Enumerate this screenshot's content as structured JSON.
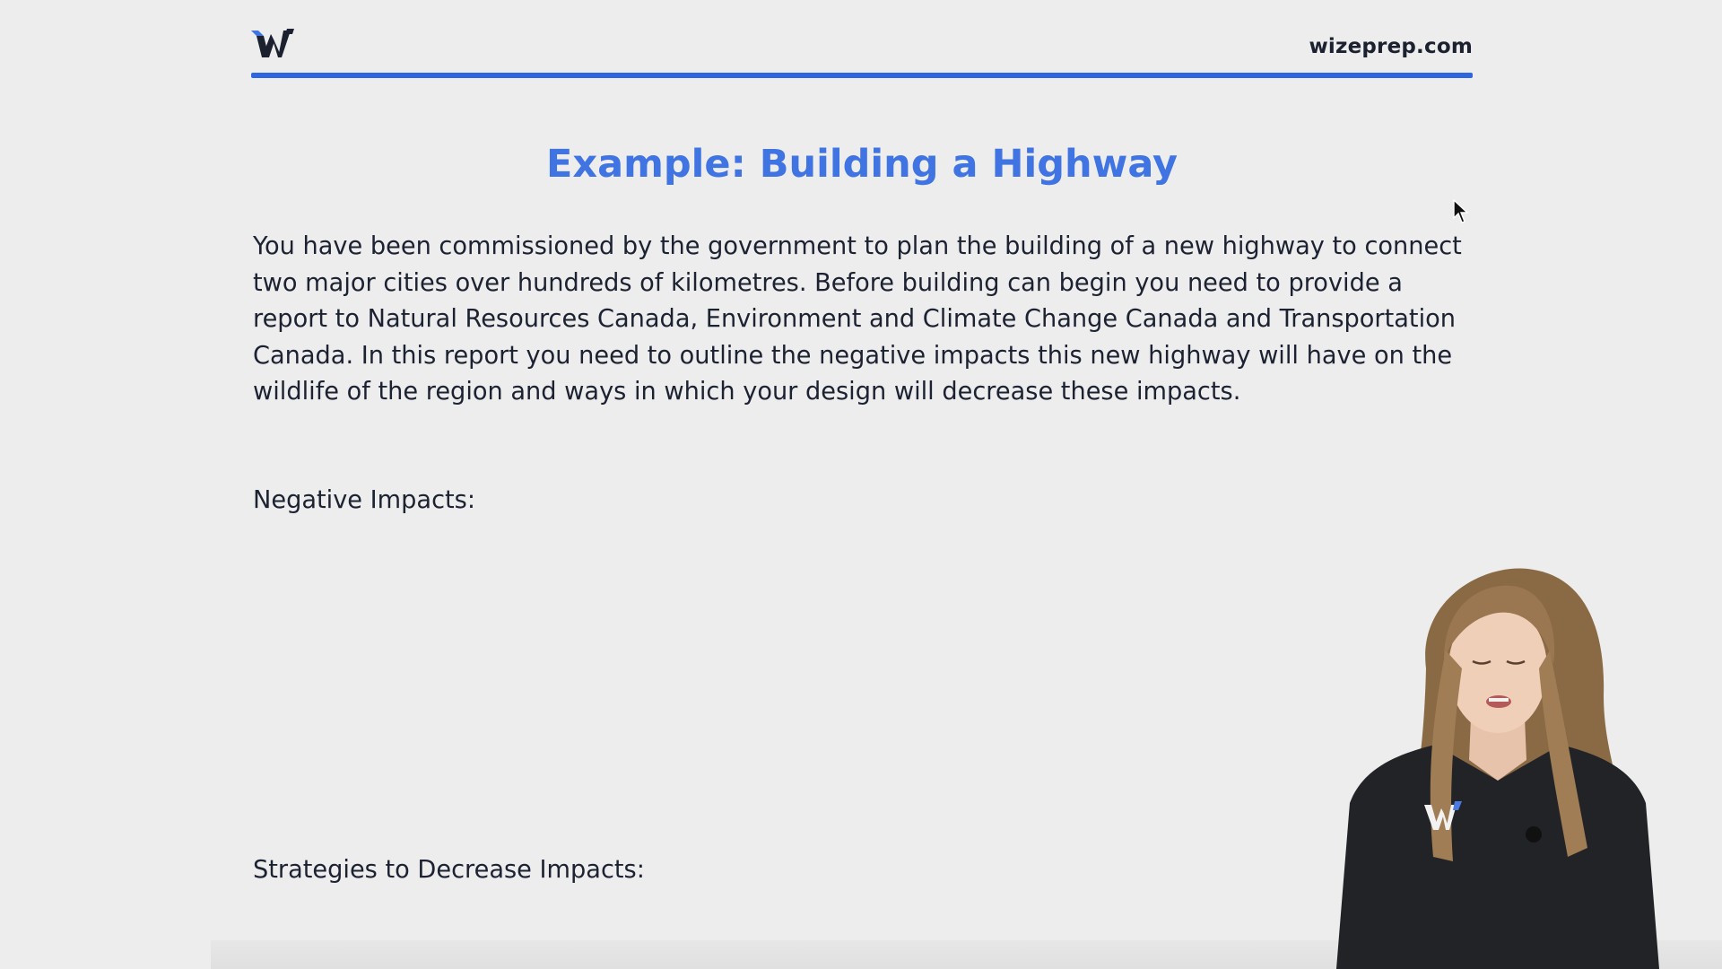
{
  "header": {
    "logo_icon": "wizeprep-w-logo-icon",
    "site_url": "wizeprep.com",
    "accent_color": "#2e66e0"
  },
  "slide": {
    "title": "Example: Building a Highway",
    "title_color": "#3f74e2",
    "body": "You have been commissioned by the government to plan the building of a new highway to connect two major cities over hundreds of kilometres. Before building can begin you need to provide a report to Natural Resources Canada, Environment and Climate Change Canada and Transportation Canada. In this report you need to outline the negative impacts this new highway will have on the wildlife of the region and ways in which your design will decrease these impacts.",
    "negative_impacts_label": "Negative Impacts:",
    "strategies_label": "Strategies to Decrease Impacts:"
  },
  "overlay": {
    "cursor_icon": "mouse-pointer-icon",
    "presenter": "presenter-webcam",
    "shirt_logo_icon": "wizeprep-w-logo-icon"
  }
}
